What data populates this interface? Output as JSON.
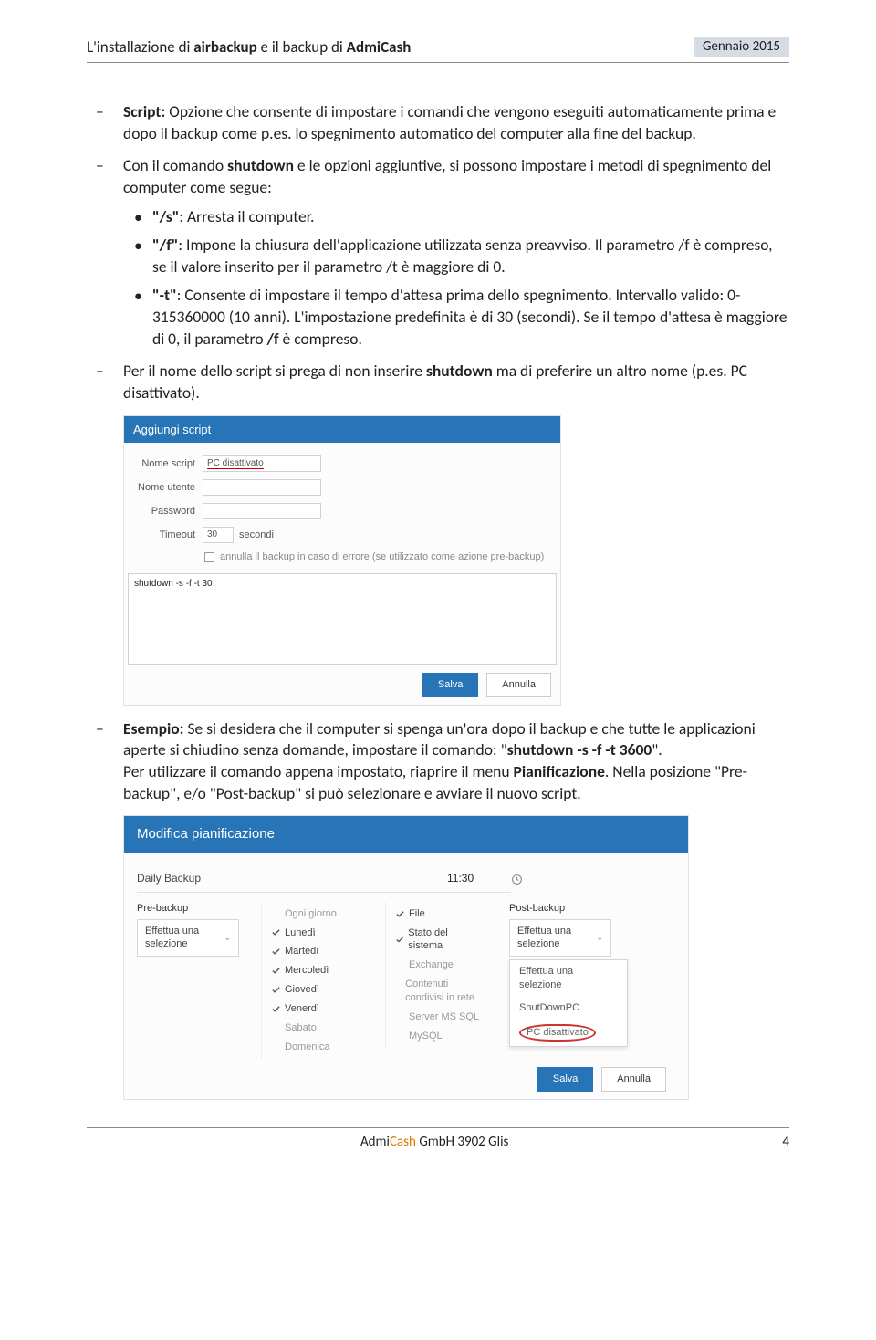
{
  "header": {
    "title_pre": "L'installazione di ",
    "title_b1": "airbackup",
    "title_mid": " e il backup di ",
    "title_b2": "AdmiCash",
    "date": "Gennaio 2015"
  },
  "d1": {
    "pre": "Script: ",
    "rest": "Opzione che consente di impostare i comandi che vengono eseguiti automaticamente prima e dopo il backup come p.es. lo spegnimento automatico del computer alla fine del backup."
  },
  "d2": {
    "p1": "Con il comando ",
    "b1": "shutdown",
    "p2": " e le opzioni aggiuntive, si possono impostare i metodi di spegnimento del computer come segue:"
  },
  "b_s": {
    "q": "\"/s\"",
    "rest": ": Arresta il computer."
  },
  "b_f": {
    "q": "\"/f\"",
    "rest": ": Impone la chiusura dell'applicazione utilizzata senza preavviso. Il parametro /f è compreso, se il valore inserito per il parametro /t è maggiore di 0."
  },
  "b_t": {
    "q": "\"-t\"",
    "p1": ": Consente di impostare il tempo d'attesa prima dello spegnimento. Intervallo valido: 0-315360000 (10 anni). L'impostazione predefinita è di 30 (secondi). Se il tempo d'attesa è maggiore di 0, il parametro ",
    "b": "/f",
    "p2": " è compreso."
  },
  "d3": {
    "p1": "Per il nome dello script si prega di non inserire ",
    "b1": "shutdown",
    "p2": " ma di preferire un altro nome (p.es. PC disattivato)."
  },
  "fig1": {
    "title": "Aggiungi script",
    "l_name": "Nome script",
    "v_name": "PC disattivato",
    "l_user": "Nome utente",
    "l_pwd": "Password",
    "l_to": "Timeout",
    "v_to": "30",
    "u_to": "secondi",
    "chk": "annulla il backup in caso di errore (se utilizzato come azione pre-backup)",
    "area": "shutdown -s -f -t 30",
    "save": "Salva",
    "cancel": "Annulla"
  },
  "d4": {
    "b1": "Esempio: ",
    "p1": "Se si desidera che il computer si spenga un'ora dopo il backup e che tutte le applicazioni aperte si chiudino senza domande, impostare il comando: \"",
    "b2": "shutdown -s -f -t 3600",
    "p2": "\".",
    "p3": "Per utilizzare il comando appena impostato, riaprire il menu ",
    "b3": "Pianificazione",
    "p4": ". Nella posizione \"Pre-backup\", e/o \"Post-backup\" si può selezionare e avviare il nuovo script."
  },
  "fig2": {
    "title": "Modifica pianificazione",
    "daily": "Daily Backup",
    "time": "11:30",
    "pre": "Pre-backup",
    "post": "Post-backup",
    "selpre": "Effettua una selezione",
    "selpost": "Effettua una selezione",
    "dd0": "Effettua una selezione",
    "dd1": "ShutDownPC",
    "dd2": "PC disattivato",
    "days": [
      "Ogni giorno",
      "Lunedì",
      "Martedì",
      "Mercoledì",
      "Giovedì",
      "Venerdì",
      "Sabato",
      "Domenica"
    ],
    "types": [
      "File",
      "Stato del sistema",
      "Exchange",
      "Contenuti condivisi in rete",
      "Server MS SQL",
      "MySQL"
    ],
    "save": "Salva",
    "cancel": "Annulla"
  },
  "footer": {
    "left": "",
    "center_pre": "Admi",
    "center_orange": "Cash",
    "center_post": " GmbH 3902 Glis",
    "page": "4"
  }
}
